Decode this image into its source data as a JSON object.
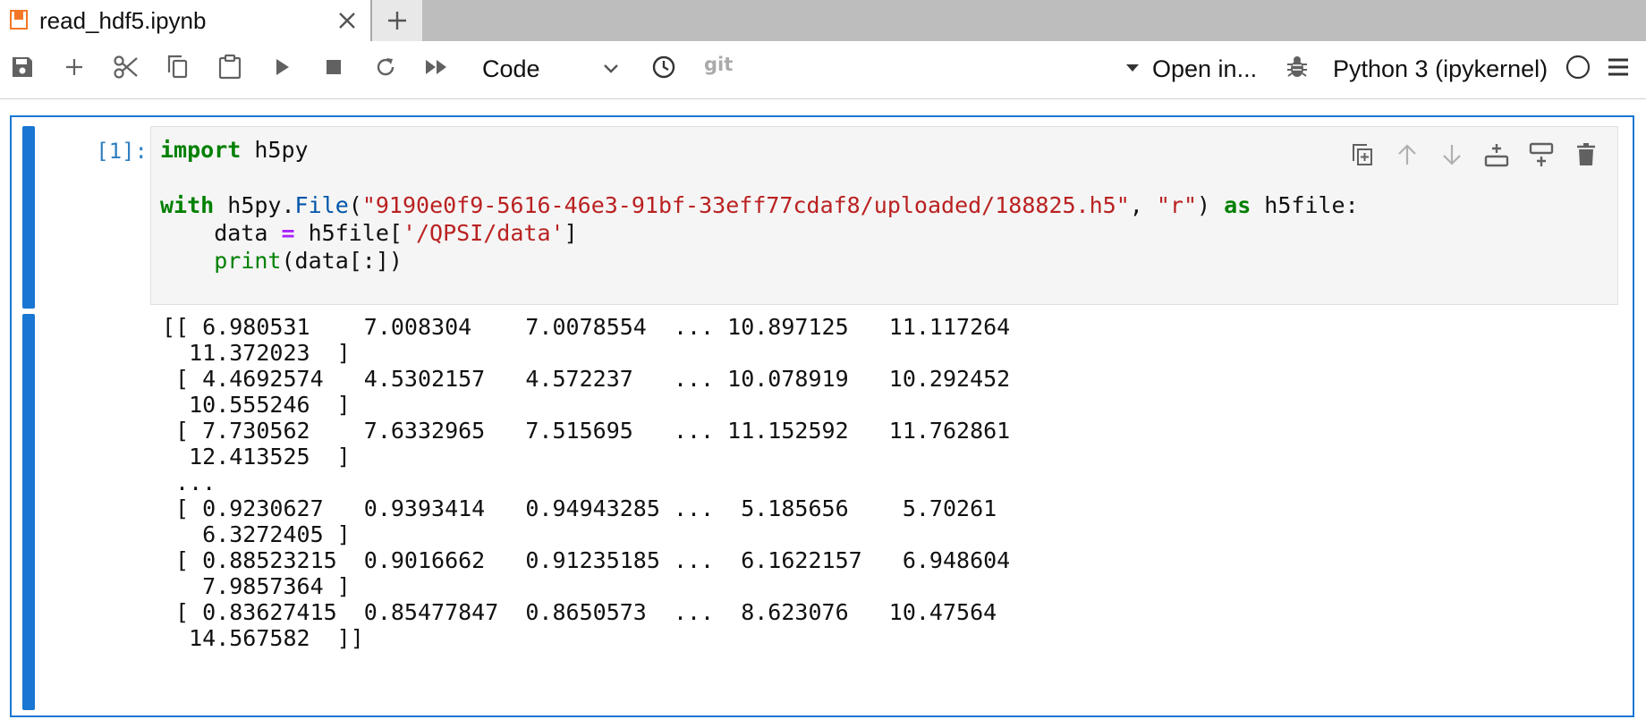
{
  "tab": {
    "title": "read_hdf5.ipynb",
    "icon": "notebook-icon",
    "close_icon": "close-icon",
    "new_tab_icon": "plus-icon"
  },
  "toolbar": {
    "icons": [
      "save-icon",
      "add-cell-icon",
      "cut-icon",
      "copy-icon",
      "paste-icon",
      "run-icon",
      "stop-icon",
      "restart-icon",
      "run-all-icon"
    ],
    "cell_type": "Code",
    "git_label": "git",
    "open_in_label": "Open in...",
    "kernel_name": "Python 3 (ipykernel)",
    "kernel_status": "idle"
  },
  "cell": {
    "prompt": "[1]:",
    "code_lines": [
      "import h5py",
      "",
      "with h5py.File(\"9190e0f9-5616-46e3-91bf-33eff77cdaf8/uploaded/188825.h5\", \"r\") as h5file:",
      "    data = h5file['/QPSI/data']",
      "    print(data[:])"
    ],
    "code_tokens": {
      "kw_import": "import",
      "mod": "h5py",
      "kw_with": "with",
      "h5py_dot": "h5py.",
      "file_fn": "File",
      "paren_open": "(",
      "path_str": "\"9190e0f9-5616-46e3-91bf-33eff77cdaf8/uploaded/188825.h5\"",
      "comma": ", ",
      "mode_str": "\"r\"",
      "paren_close_sp": ") ",
      "kw_as": "as",
      "h5file_colon": " h5file:",
      "indent_data": "    data ",
      "eq": "=",
      "h5file_sub": " h5file[",
      "key_str": "'/QPSI/data'",
      "close_br": "]",
      "indent": "    ",
      "print_fn": "print",
      "print_arg": "(data[:])"
    },
    "tools": [
      "duplicate-cell-icon",
      "move-up-icon",
      "move-down-icon",
      "insert-below-icon",
      "insert-above-icon",
      "delete-cell-icon"
    ],
    "output_lines": [
      "[[ 6.980531    7.008304    7.0078554  ... 10.897125   11.117264",
      "  11.372023  ]",
      " [ 4.4692574   4.5302157   4.572237   ... 10.078919   10.292452",
      "  10.555246  ]",
      " [ 7.730562    7.6332965   7.515695   ... 11.152592   11.762861",
      "  12.413525  ]",
      " ...",
      " [ 0.9230627   0.9393414   0.94943285 ...  5.185656    5.70261",
      "   6.3272405 ]",
      " [ 0.88523215  0.9016662   0.91235185 ...  6.1622157   6.948604",
      "   7.9857364 ]",
      " [ 0.83627415  0.85477847  0.8650573  ...  8.623076   10.47564",
      "  14.567582  ]]"
    ]
  }
}
